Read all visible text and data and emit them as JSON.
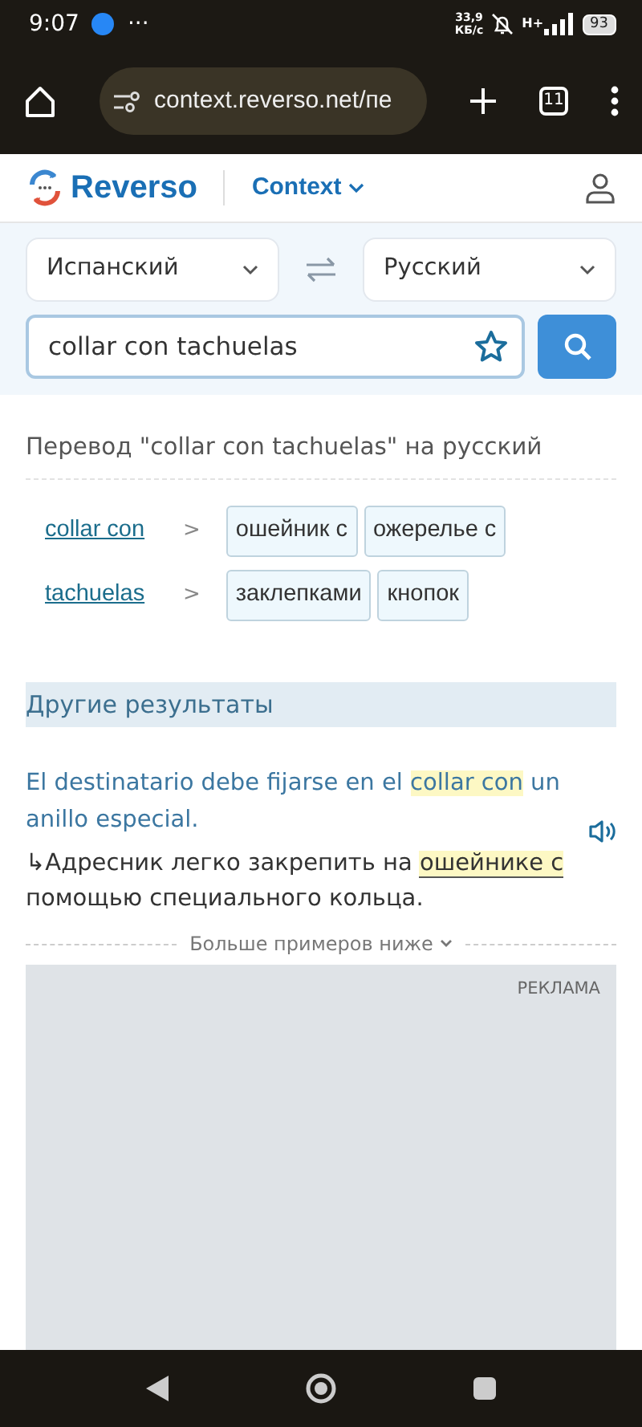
{
  "status_bar": {
    "time": "9:07",
    "dots": "···",
    "speed_value": "33,9",
    "speed_unit": "КБ/с",
    "network": "H+",
    "battery": "93"
  },
  "browser": {
    "url": "context.reverso.net/пе",
    "tab_count": "11"
  },
  "header": {
    "logo": "Reverso",
    "product": "Context"
  },
  "search": {
    "source_language": "Испанский",
    "target_language": "Русский",
    "value": "collar con tachuelas"
  },
  "translation": {
    "heading": "Перевод \"collar con tachuelas\" на русский",
    "groups": [
      {
        "term": "collar con",
        "arrow": ">",
        "translations": [
          "ошейник с",
          "ожерелье с"
        ]
      },
      {
        "term": "tachuelas",
        "arrow": ">",
        "translations": [
          "заклепками",
          "кнопок"
        ]
      }
    ]
  },
  "other_results": {
    "title": "Другие результаты"
  },
  "example": {
    "source": [
      {
        "text": "El destinatario debe fijarse en el ",
        "highlight": false
      },
      {
        "text": "collar con",
        "highlight": true
      },
      {
        "text": " un anillo especial.",
        "highlight": false
      }
    ],
    "arrow": "↳",
    "target": [
      {
        "text": "Адресник легко закрепить на ",
        "highlight": false
      },
      {
        "text": "ошейнике с",
        "highlight": true
      },
      {
        "text": " помощью специального кольца.",
        "highlight": false
      }
    ]
  },
  "more_examples": "Больше примеров ниже",
  "ad": {
    "label": "РЕКЛАМА"
  }
}
